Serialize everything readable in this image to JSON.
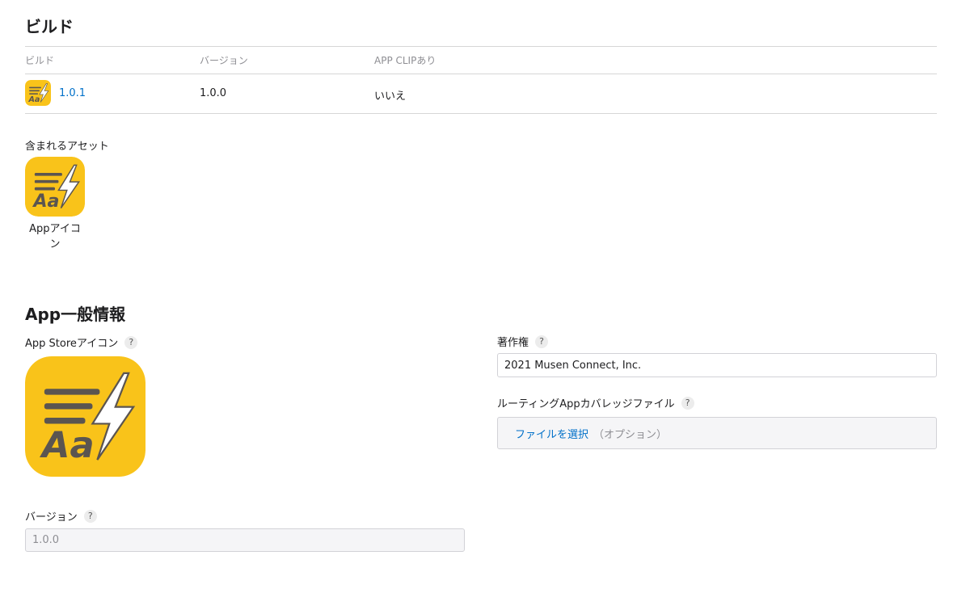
{
  "builds_section": {
    "title": "ビルド",
    "columns": [
      "ビルド",
      "バージョン",
      "APP CLIPあり"
    ],
    "rows": [
      {
        "build": "1.0.1",
        "version": "1.0.0",
        "app_clip": "いいえ"
      }
    ],
    "assets_label": "含まれるアセット",
    "asset_caption": "Appアイコン"
  },
  "general_info": {
    "title": "App一般情報",
    "app_store_icon_label": "App Storeアイコン",
    "version_label": "バージョン",
    "version_value": "1.0.0",
    "copyright_label": "著作権",
    "copyright_value": "2021 Musen Connect, Inc.",
    "routing_label": "ルーティングAppカバレッジファイル",
    "choose_file": "ファイルを選択",
    "optional": "（オプション）",
    "help_glyph": "?"
  },
  "icon": {
    "name": "app-icon-aa-lightning",
    "background": "#F9C31A",
    "lines_color": "#5b5550",
    "text": "Aa"
  }
}
